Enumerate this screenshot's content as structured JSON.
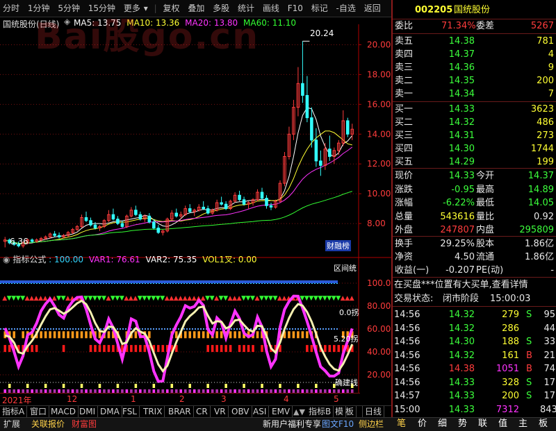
{
  "toolbar": {
    "items": [
      "分时",
      "1分钟",
      "5分钟",
      "15分钟",
      "更多",
      "复权",
      "叠加",
      "多股",
      "统计",
      "画线",
      "F10",
      "标记",
      "-自选",
      "返回"
    ]
  },
  "main_chart": {
    "title": "国统股份(日线)",
    "ma_legend": [
      {
        "label": "MA5: 13.75",
        "color": "#ffffff"
      },
      {
        "label": "MA10: 13.36",
        "color": "#ffff33"
      },
      {
        "label": "MA20: 13.80",
        "color": "#ff33ff"
      },
      {
        "label": "MA60: 11.10",
        "color": "#33ff33"
      }
    ],
    "y_ticks": [
      "20.00",
      "18.00",
      "16.00",
      "14.00",
      "12.00",
      "10.00",
      "8.00"
    ],
    "high_label": "20.24",
    "low_label": "6.36",
    "badge": "财融榜",
    "watermark": "Bai股go.cn"
  },
  "chart_data": {
    "type": "candlestick",
    "ylim": [
      6.0,
      21.0
    ],
    "xlabels": [
      "2021年",
      "12",
      "1",
      "2",
      "3",
      "4",
      "5"
    ],
    "ohlc": [
      [
        6.8,
        7.1,
        6.4,
        6.9
      ],
      [
        6.9,
        7.0,
        6.6,
        6.7
      ],
      [
        6.7,
        6.9,
        6.5,
        6.6
      ],
      [
        6.6,
        6.8,
        6.4,
        6.5
      ],
      [
        6.5,
        6.8,
        6.36,
        6.7
      ],
      [
        6.7,
        7.0,
        6.6,
        6.9
      ],
      [
        6.9,
        7.0,
        6.7,
        6.8
      ],
      [
        6.8,
        7.0,
        6.7,
        6.9
      ],
      [
        6.9,
        7.1,
        6.8,
        7.0
      ],
      [
        7.0,
        7.2,
        6.9,
        7.1
      ],
      [
        7.1,
        7.4,
        7.0,
        7.3
      ],
      [
        7.3,
        7.5,
        7.1,
        7.2
      ],
      [
        7.2,
        7.4,
        7.0,
        7.1
      ],
      [
        7.1,
        7.3,
        7.0,
        7.2
      ],
      [
        7.2,
        7.5,
        7.1,
        7.4
      ],
      [
        7.4,
        7.7,
        7.3,
        7.6
      ],
      [
        7.6,
        7.9,
        7.5,
        7.8
      ],
      [
        7.8,
        8.6,
        7.7,
        8.4
      ],
      [
        8.4,
        8.8,
        8.1,
        8.2
      ],
      [
        8.2,
        8.4,
        7.8,
        7.9
      ],
      [
        7.9,
        8.1,
        7.6,
        7.7
      ],
      [
        7.7,
        7.9,
        7.5,
        7.8
      ],
      [
        7.8,
        8.3,
        7.7,
        8.2
      ],
      [
        8.2,
        8.9,
        8.1,
        8.6
      ],
      [
        8.6,
        9.0,
        8.2,
        8.3
      ],
      [
        8.3,
        8.5,
        7.9,
        8.0
      ],
      [
        8.0,
        8.2,
        7.7,
        7.8
      ],
      [
        7.8,
        8.6,
        7.7,
        8.5
      ],
      [
        8.5,
        9.1,
        8.4,
        8.9
      ],
      [
        8.9,
        9.2,
        8.5,
        8.6
      ],
      [
        8.6,
        8.8,
        8.2,
        8.3
      ],
      [
        8.3,
        8.6,
        8.1,
        8.5
      ],
      [
        8.5,
        8.7,
        8.0,
        8.1
      ],
      [
        8.1,
        8.3,
        7.6,
        7.7
      ],
      [
        7.7,
        7.9,
        7.3,
        7.4
      ],
      [
        7.4,
        7.6,
        7.2,
        7.5
      ],
      [
        7.5,
        8.4,
        7.4,
        8.3
      ],
      [
        8.3,
        8.9,
        8.2,
        8.7
      ],
      [
        8.7,
        9.0,
        8.4,
        8.5
      ],
      [
        8.5,
        8.8,
        8.3,
        8.6
      ],
      [
        8.6,
        9.2,
        8.5,
        9.0
      ],
      [
        9.0,
        9.3,
        8.7,
        8.8
      ],
      [
        8.8,
        9.0,
        8.5,
        8.9
      ],
      [
        8.9,
        9.3,
        8.8,
        9.1
      ],
      [
        9.1,
        9.5,
        8.9,
        9.0
      ],
      [
        9.0,
        9.2,
        8.6,
        8.7
      ],
      [
        8.7,
        9.0,
        8.6,
        8.9
      ],
      [
        8.9,
        9.6,
        8.8,
        9.4
      ],
      [
        9.4,
        9.8,
        9.2,
        9.3
      ],
      [
        9.3,
        9.5,
        8.9,
        9.0
      ],
      [
        9.0,
        9.6,
        8.9,
        9.5
      ],
      [
        9.5,
        10.1,
        9.4,
        9.9
      ],
      [
        9.9,
        10.2,
        9.5,
        9.6
      ],
      [
        9.6,
        9.8,
        9.2,
        9.3
      ],
      [
        9.3,
        9.5,
        9.0,
        9.4
      ],
      [
        9.4,
        9.7,
        9.2,
        9.6
      ],
      [
        9.6,
        10.3,
        9.5,
        10.1
      ],
      [
        10.1,
        10.4,
        9.6,
        9.7
      ],
      [
        9.7,
        9.9,
        9.0,
        9.2
      ],
      [
        9.2,
        9.4,
        8.9,
        9.1
      ],
      [
        9.1,
        9.6,
        9.0,
        9.5
      ],
      [
        9.5,
        10.9,
        9.4,
        10.7
      ],
      [
        10.7,
        12.8,
        10.5,
        12.5
      ],
      [
        12.5,
        14.5,
        12.3,
        14.0
      ],
      [
        14.0,
        16.3,
        13.6,
        15.8
      ],
      [
        15.8,
        18.5,
        15.2,
        17.4
      ],
      [
        17.4,
        20.24,
        16.1,
        16.6
      ],
      [
        16.6,
        17.9,
        14.8,
        15.1
      ],
      [
        15.1,
        15.8,
        13.1,
        13.6
      ],
      [
        13.6,
        14.4,
        11.8,
        12.2
      ],
      [
        12.2,
        12.9,
        11.2,
        11.9
      ],
      [
        11.9,
        13.4,
        11.6,
        13.0
      ],
      [
        13.0,
        13.9,
        12.2,
        12.5
      ],
      [
        12.5,
        13.1,
        12.0,
        12.9
      ],
      [
        12.9,
        13.6,
        12.6,
        13.4
      ],
      [
        13.4,
        15.6,
        13.2,
        14.9
      ],
      [
        14.9,
        15.1,
        13.8,
        14.0
      ],
      [
        14.0,
        14.7,
        13.6,
        14.33
      ]
    ]
  },
  "indicator": {
    "name": "指标公式",
    "params": [
      {
        "label": ": 100.00",
        "color": "#33d6ff"
      },
      {
        "label": "VAR1: 76.61",
        "color": "#ff33ff"
      },
      {
        "label": "VAR2: 75.35",
        "color": "#ffffff"
      },
      {
        "label": "VOL1叉: 0.00",
        "color": "#ffff33"
      }
    ],
    "y_ticks": [
      "100.00",
      "80.00",
      "60.00",
      "40.00",
      "20.00"
    ],
    "tag_right": "区间统",
    "side_labels": [
      "0.0拐",
      "5.20拐",
      "确建线"
    ]
  },
  "bottom_tabs": [
    "指标A",
    "窗口",
    "MACD",
    "DMI",
    "DMA",
    "FSL",
    "TRIX",
    "BRAR",
    "CR",
    "VR",
    "OBV",
    "ASI",
    "EMV",
    "指标B",
    "模",
    "板",
    "日线"
  ],
  "status_bar": {
    "items": [
      "扩展",
      "关联报价",
      "财富图",
      "新用户福利专享",
      "图文F10",
      "侧边栏"
    ]
  },
  "quote": {
    "code": "002205",
    "name": "国统股份",
    "weibi_label": "委比",
    "weibi": "71.34%",
    "weicha_label": "委差",
    "weicha": "5267",
    "asks": [
      [
        "卖五",
        "14.38",
        "781"
      ],
      [
        "卖四",
        "14.37",
        "4"
      ],
      [
        "卖三",
        "14.36",
        "9"
      ],
      [
        "卖二",
        "14.35",
        "200"
      ],
      [
        "卖一",
        "14.34",
        "7"
      ]
    ],
    "bids": [
      [
        "买一",
        "14.33",
        "3623"
      ],
      [
        "买二",
        "14.32",
        "486"
      ],
      [
        "买三",
        "14.31",
        "273"
      ],
      [
        "买四",
        "14.30",
        "1744"
      ],
      [
        "买五",
        "14.29",
        "199"
      ]
    ],
    "stats": [
      [
        "现价",
        "14.33",
        "今开",
        "14.37"
      ],
      [
        "涨跌",
        "-0.95",
        "最高",
        "14.89"
      ],
      [
        "涨幅",
        "-6.22%",
        "最低",
        "14.05"
      ],
      [
        "总量",
        "543616",
        "量比",
        "0.92"
      ],
      [
        "外盘",
        "247807",
        "内盘",
        "295809"
      ]
    ],
    "stats2": [
      [
        "换手",
        "29.25%",
        "股本",
        "1.86亿"
      ],
      [
        "净资",
        "4.50",
        "流通",
        "1.86亿"
      ],
      [
        "收益(一)",
        "-0.207",
        "PE(动)",
        "-"
      ]
    ],
    "notice": "在买盘***位置有大买单,查看详情",
    "trade_status_label": "交易状态:",
    "trade_status": "闭市阶段",
    "trade_time": "15:00:03",
    "ticks": [
      [
        "14:56",
        "14.32",
        "279",
        "S",
        "95"
      ],
      [
        "14:56",
        "14.32",
        "286",
        "",
        "44"
      ],
      [
        "14:56",
        "14.30",
        "188",
        "S",
        "33"
      ],
      [
        "14:56",
        "14.32",
        "161",
        "B",
        "21"
      ],
      [
        "14:56",
        "14.38",
        "1051",
        "B",
        "74"
      ],
      [
        "14:56",
        "14.33",
        "328",
        "S",
        "17"
      ],
      [
        "14:57",
        "14.33",
        "200",
        "S",
        "17"
      ],
      [
        "15:00",
        "14.33",
        "7312",
        "",
        "843"
      ]
    ],
    "tabs": [
      "笔",
      "价",
      "细",
      "势",
      "联",
      "值",
      "主",
      "板"
    ]
  },
  "colors": {
    "up": "#ff3c3c",
    "down": "#33ffff",
    "grid": "#7a1010",
    "axis": "#b00000"
  }
}
